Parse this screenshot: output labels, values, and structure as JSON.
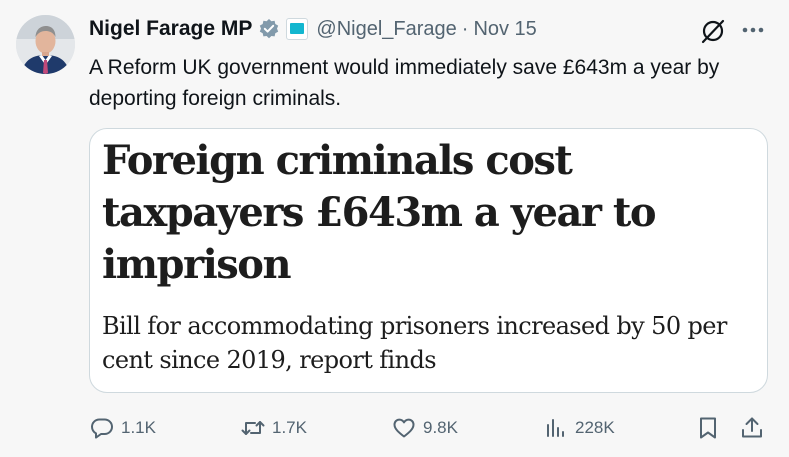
{
  "author": {
    "name": "Nigel Farage MP",
    "handle": "@Nigel_Farage",
    "separator": "·",
    "date": "Nov 15",
    "verified_badge": "verified-badge-icon",
    "affiliation_badge": "reform-uk-affiliate-icon"
  },
  "tweet": {
    "text": "A Reform UK government would immediately save £643m a year by deporting foreign criminals."
  },
  "card": {
    "headline": "Foreign criminals cost taxpayers £643m a year to imprison",
    "standfirst": "Bill for accommodating prisoners increased by 50 per cent since 2019, report finds"
  },
  "actions": {
    "replies": "1.1K",
    "reposts": "1.7K",
    "likes": "9.8K",
    "views": "228K"
  },
  "icons": [
    "grok-icon",
    "more-icon",
    "reply-icon",
    "repost-icon",
    "like-icon",
    "views-icon",
    "bookmark-icon",
    "share-icon"
  ],
  "colors": {
    "text": "#0f1419",
    "secondary": "#536471",
    "verified": "#829aab",
    "affiliate": "#12b6cf",
    "border": "#cfd9de",
    "background": "#f7f7f7"
  }
}
